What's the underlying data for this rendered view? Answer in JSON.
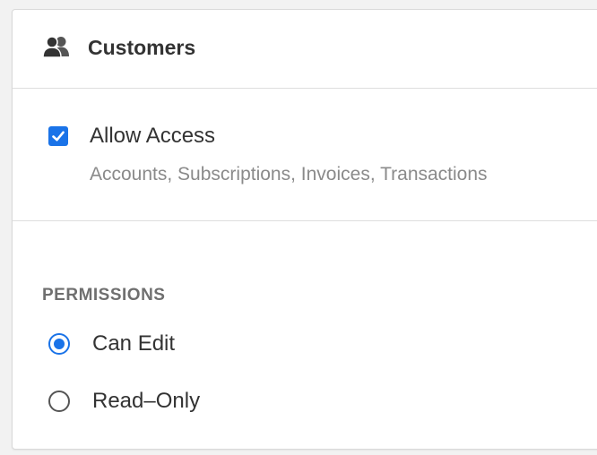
{
  "header": {
    "title": "Customers",
    "icon": "users-icon"
  },
  "access": {
    "checked": true,
    "label": "Allow Access",
    "description": "Accounts, Subscriptions, Invoices, Transactions"
  },
  "permissions": {
    "heading": "PERMISSIONS",
    "options": [
      {
        "label": "Can Edit",
        "selected": true
      },
      {
        "label": "Read–Only",
        "selected": false
      }
    ]
  },
  "colors": {
    "accent": "#1a73e8",
    "text": "#333333",
    "muted": "#8a8a8a",
    "heading": "#6f6f6f"
  }
}
